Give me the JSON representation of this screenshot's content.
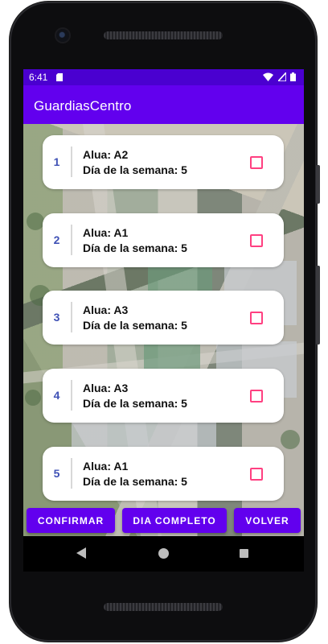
{
  "status_bar": {
    "time": "6:41",
    "icons": [
      "sd-card-icon",
      "wifi-icon",
      "cell-signal-icon",
      "battery-icon"
    ]
  },
  "app_bar": {
    "title": "GuardiasCentro"
  },
  "guards": [
    {
      "number": "1",
      "line1": "Alua: A2",
      "line2": "Día de la semana: 5",
      "checked": false
    },
    {
      "number": "2",
      "line1": "Alua: A1",
      "line2": "Día de la semana: 5",
      "checked": false
    },
    {
      "number": "3",
      "line1": "Alua: A3",
      "line2": "Día de la semana: 5",
      "checked": false
    },
    {
      "number": "4",
      "line1": "Alua: A3",
      "line2": "Día de la semana: 5",
      "checked": false
    },
    {
      "number": "5",
      "line1": "Alua: A1",
      "line2": "Día de la semana: 5",
      "checked": false
    }
  ],
  "buttons": {
    "confirm": "CONFIRMAR",
    "full_day": "DIA COMPLETO",
    "back": "VOLVER"
  },
  "colors": {
    "status_bar": "#4a00d0",
    "primary": "#6200ee",
    "number_text": "#3f51b5",
    "checkbox_border": "#ff4081"
  }
}
